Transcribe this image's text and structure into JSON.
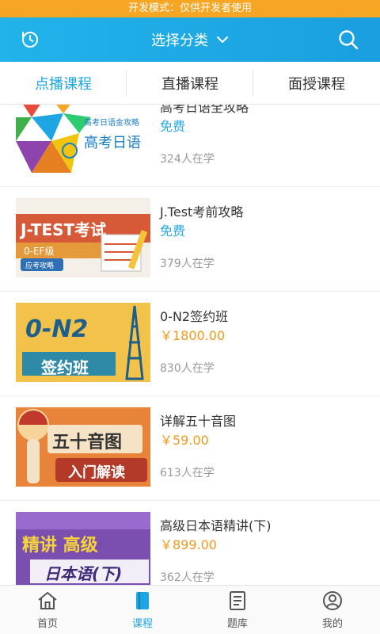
{
  "devbar": {
    "text": "开发模式：仅供开发者使用"
  },
  "header": {
    "title": "选择分类",
    "history_icon": "clock-history-icon",
    "search_icon": "search-icon"
  },
  "tabs": [
    {
      "label": "点播课程",
      "active": true
    },
    {
      "label": "直播课程",
      "active": false
    },
    {
      "label": "面授课程",
      "active": false
    }
  ],
  "courses": [
    {
      "title": "高考日语全攻略",
      "price": "免费",
      "students": "324人在学",
      "thumb_text": "高考日语",
      "thumb_sub": "高考日语金攻略",
      "color": "#1ea5e3"
    },
    {
      "title": "J.Test考前攻略",
      "price": "免费",
      "students": "379人在学",
      "thumb_text": "J-TEST考试",
      "thumb_sub": "0-EF级",
      "thumb_tag": "应考攻略",
      "color": "#d75a38"
    },
    {
      "title": "0-N2签约班",
      "price": "￥1800.00",
      "students": "830人在学",
      "thumb_text": "0-N2",
      "thumb_sub": "签约班",
      "color": "#f3c24a"
    },
    {
      "title": "详解五十音图",
      "price": "￥59.00",
      "students": "613人在学",
      "thumb_text": "五十音图",
      "thumb_sub": "入门解读",
      "color": "#e8843a"
    },
    {
      "title": "高级日本语精讲(下)",
      "price": "￥899.00",
      "students": "362人在学",
      "thumb_text": "精讲 高级",
      "thumb_sub": "日本语(下)",
      "color": "#7b4fb0"
    }
  ],
  "bottomnav": [
    {
      "label": "首页",
      "icon": "home-icon",
      "active": false
    },
    {
      "label": "课程",
      "icon": "book-icon",
      "active": true
    },
    {
      "label": "题库",
      "icon": "document-icon",
      "active": false
    },
    {
      "label": "我的",
      "icon": "user-icon",
      "active": false
    }
  ]
}
